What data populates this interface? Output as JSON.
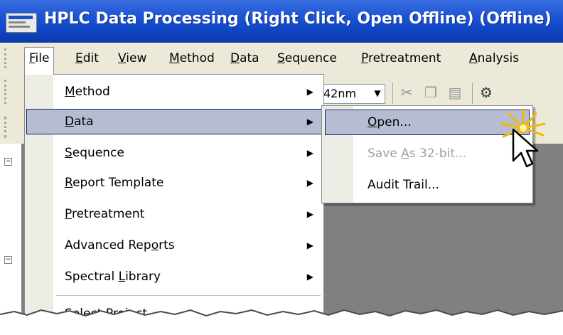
{
  "window": {
    "title": "HPLC Data Processing (Right Click, Open Offline) (Offline)"
  },
  "menubar": {
    "items": [
      {
        "label_prefix": "",
        "label_mnemonic": "F",
        "label_suffix": "ile"
      },
      {
        "label_prefix": "",
        "label_mnemonic": "E",
        "label_suffix": "dit"
      },
      {
        "label_prefix": "",
        "label_mnemonic": "V",
        "label_suffix": "iew"
      },
      {
        "label_prefix": "",
        "label_mnemonic": "M",
        "label_suffix": "ethod"
      },
      {
        "label_prefix": "",
        "label_mnemonic": "D",
        "label_suffix": "ata"
      },
      {
        "label_prefix": "",
        "label_mnemonic": "S",
        "label_suffix": "equence"
      },
      {
        "label_prefix": "",
        "label_mnemonic": "P",
        "label_suffix": "retreatment"
      },
      {
        "label_prefix": "",
        "label_mnemonic": "A",
        "label_suffix": "nalysis"
      }
    ]
  },
  "toolbar": {
    "wavelength_value": "42nm"
  },
  "file_menu": {
    "items": [
      {
        "pre": "",
        "mn": "M",
        "post": "ethod",
        "submenu": true
      },
      {
        "pre": "",
        "mn": "D",
        "post": "ata",
        "submenu": true
      },
      {
        "pre": "",
        "mn": "S",
        "post": "equence",
        "submenu": true
      },
      {
        "pre": "",
        "mn": "R",
        "post": "eport Template",
        "submenu": true
      },
      {
        "pre": "",
        "mn": "P",
        "post": "retreatment",
        "submenu": true
      },
      {
        "pre": "Advanced Rep",
        "mn": "o",
        "post": "rts",
        "submenu": true
      },
      {
        "pre": "Spectral ",
        "mn": "L",
        "post": "ibrary",
        "submenu": true
      },
      {
        "pre": "Select ",
        "mn": "P",
        "post": "roject...",
        "submenu": false
      }
    ]
  },
  "data_submenu": {
    "items": [
      {
        "pre": "",
        "mn": "O",
        "post": "pen...",
        "enabled": true
      },
      {
        "pre": "Save ",
        "mn": "A",
        "post": "s 32-bit...",
        "enabled": false
      },
      {
        "pre": "Audit Trail...",
        "mn": "",
        "post": "",
        "enabled": true
      }
    ]
  },
  "colors": {
    "titlebar": "#1f56d6",
    "menu_highlight": "#b6bdd2",
    "menu_highlight_border": "#0a246a",
    "chrome": "#ece9d8",
    "client_bg": "#808080"
  },
  "icons": [
    "app-icon",
    "cut-icon",
    "copy-icon",
    "paste-icon",
    "toolbar-tool-icon",
    "submenu-arrow-icon",
    "mouse-pointer-icon",
    "click-sparkle-icon"
  ]
}
